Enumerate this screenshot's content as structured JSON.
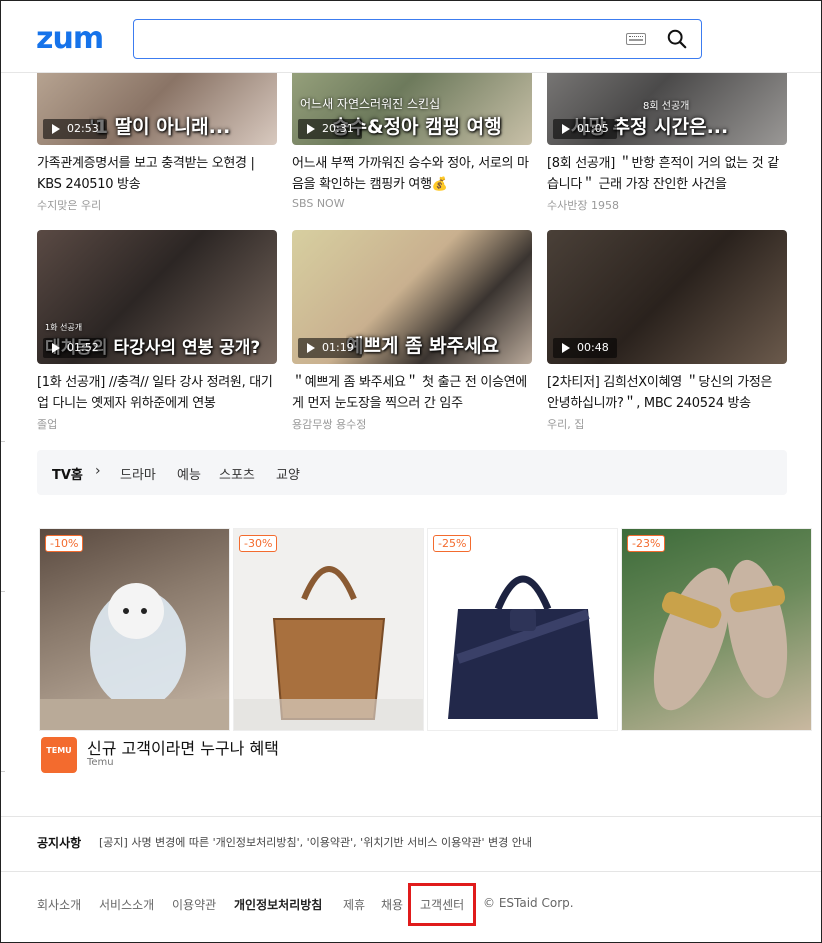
{
  "header": {
    "logo": "zum",
    "search_placeholder": ""
  },
  "videos": [
    {
      "caption": "'1 딸이 아니래...",
      "duration": "02:53",
      "title": "가족관계증명서를 보고 충격받는 오현경 | KBS 240510 방송",
      "source": "수지맞은 우리"
    },
    {
      "caption": "승수&정아 캠핑 여행",
      "subcap": "어느새 자연스러워진 스킨십",
      "duration": "20:31",
      "title": "어느새 부쩍 가까워진 승수와 정아, 서로의 마음을 확인하는 캠핑카 여행💰",
      "source": "SBS NOW"
    },
    {
      "caption": "사망 추정 시간은...",
      "subcap": "8회 선공개",
      "duration": "01:05",
      "title": "[8회 선공개] ＂반항 흔적이 거의 없는 것 같습니다＂ 근래 가장 잔인한 사건을",
      "source": "수사반장 1958"
    },
    {
      "caption": "대치동의 타강사의 연봉 공개?",
      "subcap": "1화 선공개",
      "duration": "01:52",
      "title": "[1화 선공개] //충격// 일타 강사 정려원, 대기업 다니는 옛제자 위하준에게 연봉",
      "source": "졸업"
    },
    {
      "caption": "예쁘게 좀 봐주세요",
      "duration": "01:19",
      "title": "＂예쁘게 좀 봐주세요＂ 첫 출근 전 이승연에게 먼저 눈도장을 찍으러 간 임주",
      "source": "용감무쌍 용수정"
    },
    {
      "caption": "",
      "duration": "00:48",
      "title": "[2차티저] 김희선X이혜영 ＂당신의 가정은 안녕하십니까?＂, MBC 240524 방송",
      "source": "우리, 집"
    }
  ],
  "tvnav": {
    "home": "TV홈",
    "chevron": "›",
    "categories": [
      "드라마",
      "예능",
      "스포츠",
      "교양"
    ]
  },
  "ad": {
    "discounts": [
      "-10%",
      "-30%",
      "-25%",
      "-23%"
    ],
    "brand_logo": "TEMU",
    "title": "신규 고객이라면 누구나 혜택",
    "subtitle": "Temu"
  },
  "notice": {
    "label": "공지사항",
    "text": "[공지] 사명 변경에 따른 '개인정보처리방침', '이용약관', '위치기반 서비스 이용약관' 변경 안내"
  },
  "footer": {
    "links": [
      "회사소개",
      "서비스소개",
      "이용약관",
      "개인정보처리방침",
      "제휴",
      "채용",
      "고객센터"
    ],
    "copyright": "© ESTaid Corp."
  },
  "colors": {
    "brand": "#1673ea",
    "discount": "#f36b2e",
    "highlight": "#e01b1b"
  }
}
